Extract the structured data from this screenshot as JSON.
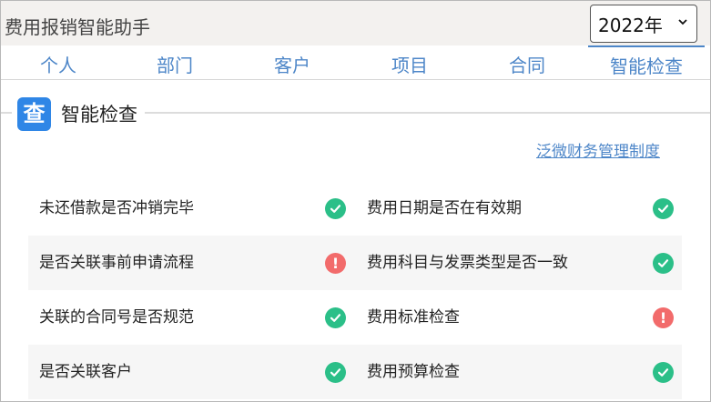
{
  "app": {
    "title": "费用报销智能助手"
  },
  "year_select": {
    "value": "2022年"
  },
  "tabs": [
    {
      "label": "个人",
      "active": false
    },
    {
      "label": "部门",
      "active": false
    },
    {
      "label": "客户",
      "active": false
    },
    {
      "label": "项目",
      "active": false
    },
    {
      "label": "合同",
      "active": false
    },
    {
      "label": "智能检查",
      "active": true
    }
  ],
  "section": {
    "badge_char": "查",
    "title": "智能检查"
  },
  "policy_link": "泛微财务管理制度",
  "checks": [
    {
      "left": {
        "label": "未还借款是否冲销完毕",
        "status": "ok"
      },
      "right": {
        "label": "费用日期是否在有效期",
        "status": "ok"
      }
    },
    {
      "left": {
        "label": "是否关联事前申请流程",
        "status": "warn"
      },
      "right": {
        "label": "费用科目与发票类型是否一致",
        "status": "ok"
      }
    },
    {
      "left": {
        "label": "关联的合同号是否规范",
        "status": "ok"
      },
      "right": {
        "label": "费用标准检查",
        "status": "warn"
      }
    },
    {
      "left": {
        "label": "是否关联客户",
        "status": "ok"
      },
      "right": {
        "label": "费用预算检查",
        "status": "ok"
      }
    }
  ],
  "colors": {
    "accent": "#4d86c8",
    "ok": "#2bbf88",
    "warn": "#f26b6b",
    "badge": "#2f86e6"
  }
}
